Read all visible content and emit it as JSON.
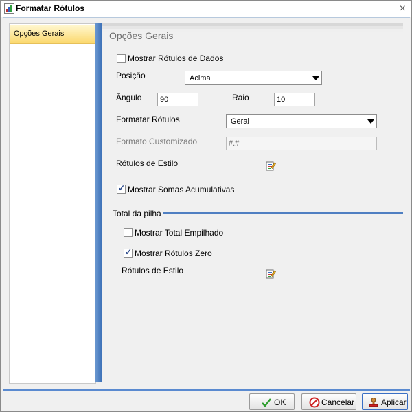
{
  "window": {
    "title": "Formatar Rótulos",
    "close_glyph": "×"
  },
  "sidebar": {
    "items": [
      {
        "label": "Opções Gerais",
        "selected": true
      }
    ]
  },
  "panel": {
    "title": "Opções Gerais",
    "show_data_labels": {
      "label": "Mostrar Rótulos de Dados",
      "checked": false
    },
    "position": {
      "label": "Posição",
      "value": "Acima"
    },
    "angle": {
      "label": "Ângulo",
      "value": "90"
    },
    "radius": {
      "label": "Raio",
      "value": "10"
    },
    "format_labels": {
      "label": "Formatar Rótulos",
      "value": "Geral"
    },
    "custom_format": {
      "label": "Formato Customizado",
      "value": "#.#"
    },
    "style_labels": {
      "label": "Rótulos de Estilo",
      "icon": "edit-style-icon"
    },
    "show_cumulative": {
      "label": "Mostrar Somas Acumulativas",
      "checked": true
    },
    "stack_section": {
      "title": "Total da pilha",
      "show_stacked_total": {
        "label": "Mostrar Total Empilhado",
        "checked": false
      },
      "show_zero_labels": {
        "label": "Mostrar Rótulos Zero",
        "checked": true
      },
      "style_labels": {
        "label": "Rótulos de Estilo",
        "icon": "edit-style-icon"
      }
    }
  },
  "buttons": {
    "ok": {
      "label": "OK",
      "icon": "checkmark-icon"
    },
    "cancel": {
      "label": "Cancelar",
      "icon": "no-entry-icon"
    },
    "apply": {
      "label": "Aplicar",
      "icon": "apply-stamp-icon"
    }
  },
  "colors": {
    "accent": "#4f7fc2",
    "selected_item": "#fbd86d",
    "ok_check": "#2e9e2e",
    "cancel_red": "#cc2222"
  }
}
